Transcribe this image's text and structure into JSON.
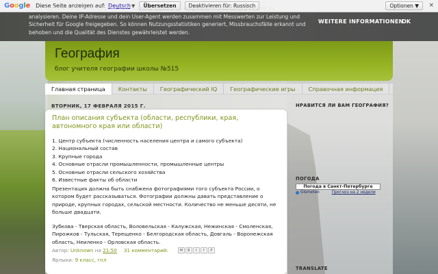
{
  "translate_bar": {
    "logo": "Google",
    "prompt": "Diese Seite anzeigen auf:",
    "language": "Deutsch",
    "translate_button": "Übersetzen",
    "disable_button": "Deaktivieren für: Russisch",
    "options": "Optionen ▼",
    "close": "×"
  },
  "cookie_banner": {
    "text": "Diese Website verwendet Cookies von Google, um ihre Dienste bereitzustellen und Zugriffe zu analysieren. Deine IP-Adresse und dein User-Agent werden zusammen mit Messwerten zur Leistung und Sicherheit für Google freigegeben. So können Nutzungsstatistiken generiert, Missbrauchsfälle erkannt und behoben und die Qualität des Dienstes gewährleistet werden.",
    "more_info": "WEITERE INFORMATIONEN",
    "ok": "OK"
  },
  "header": {
    "title": "География",
    "description": "блог учителя географии школы №515"
  },
  "tabs": [
    {
      "label": "Главная страница",
      "active": true
    },
    {
      "label": "Контакты",
      "active": false
    },
    {
      "label": "Географический IQ",
      "active": false
    },
    {
      "label": "Географические игры",
      "active": false
    },
    {
      "label": "Справочная информация",
      "active": false
    }
  ],
  "post": {
    "date": "ВТОРНИК, 17 ФЕВРАЛЯ 2015 Г.",
    "title": "План описания субъекта (области, республики, края, автономного края или области)",
    "list": [
      "1. Центр субъекта (численность населения центра и самого субъекта)",
      "2. Национальный состав",
      "3. Крупные города",
      "4. Основные отрасли промышленности, промышленные центры",
      "5. Основные отрасли сельского хозяйства",
      "6. Известные факты об области"
    ],
    "paragraph1": "Презентация должна быть снабжена фотографиями того субъекта России, о котором будет рассказываться. Фотографии должны давать представление о природе, крупных городах, сельской местности. Количество не меньше десяти, не больше двадцати.",
    "paragraph2": "Зубкова - Тверская область, Воловельская - Калужская, Нежинская - Смоленская, Пирожков - Тульская, Терещенко - Белгородская область, Довгаль - Воронежская область, Неиленко - Орловская область.",
    "author_prefix": "Автор:",
    "author": "Unknown",
    "time_prefix": "на",
    "time": "21:50",
    "comments": "31 комментарий:",
    "share_icons": [
      "M",
      "B",
      "t",
      "f",
      "P"
    ],
    "labels_prefix": "Ярлыки:",
    "labels": "9 класс, гпл"
  },
  "sidebar": {
    "like_heading": "НРАВИТСЯ ЛИ ВАМ ГЕОГРАФИЯ?",
    "weather_heading": "ПОГОДА",
    "weather_title": "Погода в Санкт-Петербурге",
    "weather_brand": "Gismeteo",
    "weather_forecast": "Прогноз на 2 недели",
    "translate_heading": "TRANSLATE"
  },
  "colors": {
    "accent": "#7b9418",
    "header_green": "#96b323",
    "banner": "#464646"
  }
}
